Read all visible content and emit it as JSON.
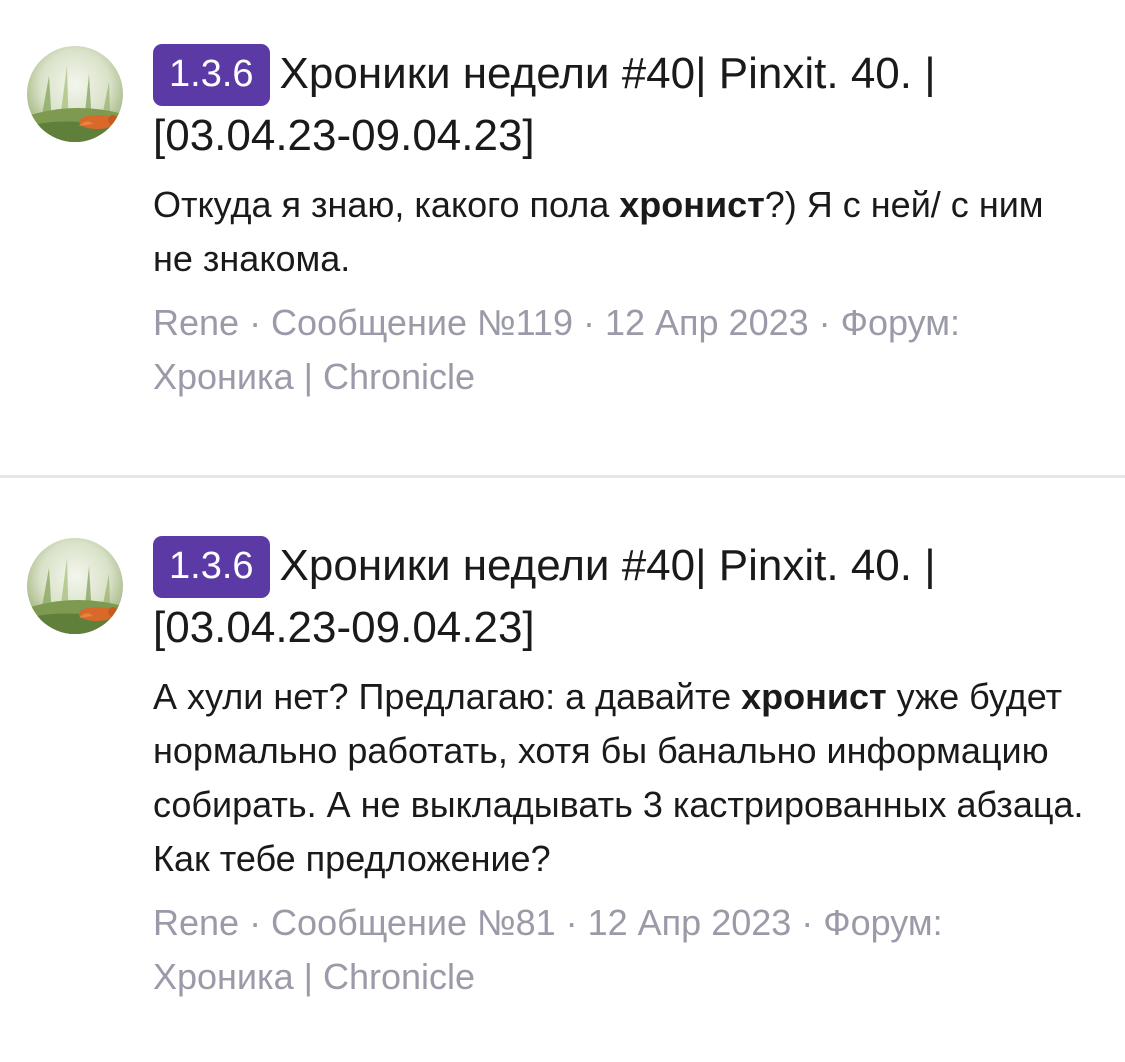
{
  "results": [
    {
      "badge": "1.3.6",
      "title": "Хроники недели #40| Pinxit. 40. | [03.04.23-09.04.23]",
      "excerpt_before": "Откуда я знаю, какого пола ",
      "excerpt_highlight": "хронист",
      "excerpt_after": "?) Я с ней/ с ним не знакома.",
      "meta": "Rene · Сообщение №119 · 12 Апр 2023 · Форум: Хроника | Chronicle"
    },
    {
      "badge": "1.3.6",
      "title": "Хроники недели #40| Pinxit. 40. | [03.04.23-09.04.23]",
      "excerpt_before": "А хули нет? Предлагаю: а давайте ",
      "excerpt_highlight": "хронист",
      "excerpt_after": " уже будет нормально работать, хотя бы банально информацию собирать. А не выкладывать 3 кастрированных абзаца. Как тебе предложение?",
      "meta": "Rene · Сообщение №81 · 12 Апр 2023 · Форум: Хроника | Chronicle"
    }
  ],
  "icons": {
    "avatar": "avatar-fox-in-grass"
  },
  "colors": {
    "badge_bg": "#5b3aa6",
    "meta_text": "#9a9aa8",
    "divider": "#e6e6ea"
  }
}
